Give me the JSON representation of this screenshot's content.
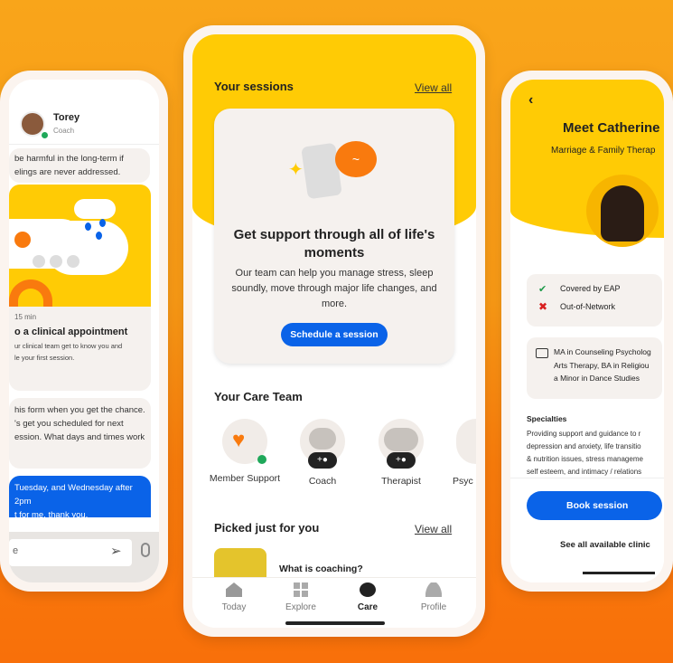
{
  "chat": {
    "contact_name": "Torey",
    "contact_role": "Coach",
    "msg1": "be harmful in the long-term if\nelings are never addressed.",
    "card_duration": "15 min",
    "card_title": "o a clinical appointment",
    "card_desc": "ur clinical team get to know you and\nle your first session.",
    "msg2": "his form when you get the chance.\n's get you scheduled for next\nession. What days and times work",
    "msg_user": "Tuesday, and Wednesday after 2pm\nt for me, thank you.",
    "input_placeholder": "e"
  },
  "home": {
    "sessions_title": "Your sessions",
    "sessions_view_all": "View all",
    "support_title": "Get support through all of life's moments",
    "support_desc": "Our team can help you manage stress, sleep soundly, move through major life changes, and more.",
    "schedule_button": "Schedule a session",
    "care_team_title": "Your Care Team",
    "care_team": [
      {
        "label": "Member Support"
      },
      {
        "label": "Coach"
      },
      {
        "label": "Therapist"
      },
      {
        "label": "Psyc"
      }
    ],
    "picked_title": "Picked just for you",
    "picked_view_all": "View all",
    "picked_item": "What is coaching?",
    "nav": [
      {
        "label": "Today",
        "icon": "home-icon"
      },
      {
        "label": "Explore",
        "icon": "grid-icon"
      },
      {
        "label": "Care",
        "icon": "chat-icon",
        "active": true
      },
      {
        "label": "Profile",
        "icon": "person-icon"
      }
    ]
  },
  "profile": {
    "title": "Meet Catherine",
    "subtitle": "Marriage & Family Therap",
    "covered": "Covered by EAP",
    "out_network": "Out-of-Network",
    "education": "MA in Counseling Psycholog\nArts Therapy, BA in Religiou\na Minor in Dance Studies",
    "specialties_title": "Specialties",
    "specialties": "Providing support and guidance to r\ndepression and anxiety, life transitio\n& nutrition issues, stress manageme\nself esteem, and intimacy / relations",
    "book_button": "Book session",
    "see_all": "See all available clinic"
  },
  "colors": {
    "yellow": "#ffcb05",
    "orange": "#f97a0e",
    "blue": "#0a63e8"
  }
}
